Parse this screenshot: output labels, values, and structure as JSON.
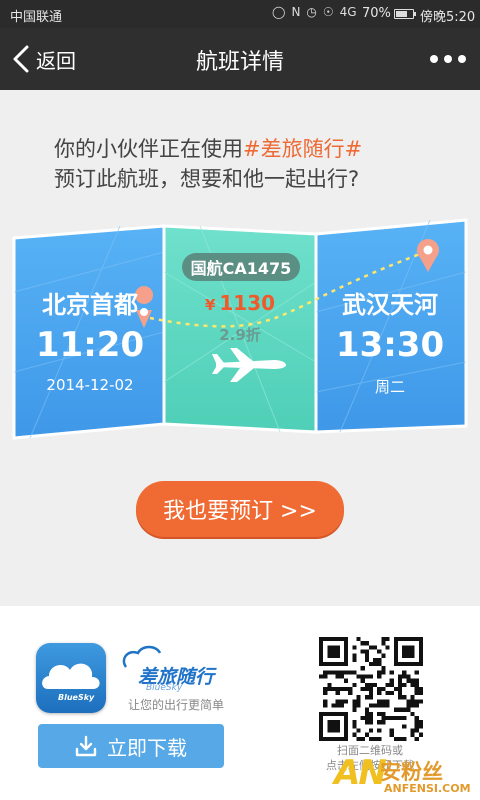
{
  "status_bar": {
    "carrier": "中国联通",
    "signal_label": "4G",
    "battery": "70%",
    "battery_level": 0.7,
    "time": "傍晚5:20"
  },
  "navbar": {
    "back_label": "返回",
    "title": "航班详情"
  },
  "intro": {
    "line1_prefix": "你的小伙伴正在使用",
    "line1_highlight": "#差旅随行#",
    "line2": "预订此航班，想要和他一起出行?"
  },
  "ticket": {
    "departure": {
      "city": "北京首都",
      "time": "11:20",
      "date": "2014-12-02"
    },
    "flight": {
      "code": "国航CA1475",
      "currency": "¥",
      "price": "1130",
      "discount": "2.9折"
    },
    "arrival": {
      "city": "武汉天河",
      "time": "13:30",
      "weekday": "周二"
    }
  },
  "book_button": {
    "label": "我也要预订 >>"
  },
  "app_promo": {
    "icon_label": "BlueSky",
    "brand_name": "差旅随行",
    "brand_sub": "BlueSky",
    "slogan": "让您的出行更简单",
    "download_label": "立即下载",
    "qr_caption_line1": "扫面二维码或",
    "qr_caption_line2": "点击左侧按钮下载"
  },
  "watermark": {
    "logo_text": "AN",
    "cn": "安粉丝",
    "en": "ANFENSI.COM"
  },
  "colors": {
    "accent_orange": "#f06a34",
    "panel_blue": "#4ea7ef",
    "panel_teal": "#5fd6c0",
    "download_blue": "#56a8e6"
  }
}
